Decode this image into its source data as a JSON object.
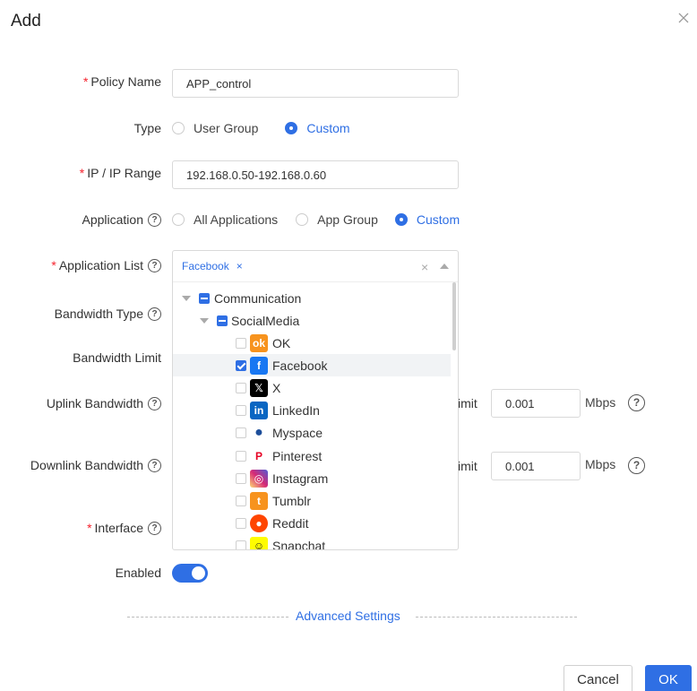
{
  "dialog": {
    "title": "Add"
  },
  "form": {
    "policy_name": {
      "label": "Policy Name",
      "value": "APP_control"
    },
    "type": {
      "label": "Type",
      "options": [
        "User Group",
        "Custom"
      ],
      "selected": "Custom"
    },
    "ip_range": {
      "label": "IP / IP Range",
      "value": "192.168.0.50-192.168.0.60"
    },
    "application": {
      "label": "Application",
      "options": [
        "All Applications",
        "App Group",
        "Custom"
      ],
      "selected": "Custom"
    },
    "application_list": {
      "label": "Application List",
      "selected_tag": "Facebook",
      "tag_remove": "×",
      "clear": "×",
      "tree": {
        "category": "Communication",
        "subcategory": "SocialMedia",
        "apps": [
          {
            "name": "OK",
            "checked": false,
            "icon": "ok-icon",
            "color": "#f7931e"
          },
          {
            "name": "Facebook",
            "checked": true,
            "icon": "facebook-icon",
            "color": "#1877f2"
          },
          {
            "name": "X",
            "checked": false,
            "icon": "x-icon",
            "color": "#000000"
          },
          {
            "name": "LinkedIn",
            "checked": false,
            "icon": "linkedin-icon",
            "color": "#0a66c2"
          },
          {
            "name": "Myspace",
            "checked": false,
            "icon": "myspace-icon",
            "color": "#1d4e9a"
          },
          {
            "name": "Pinterest",
            "checked": false,
            "icon": "pinterest-icon",
            "color": "#e60023"
          },
          {
            "name": "Instagram",
            "checked": false,
            "icon": "instagram-icon",
            "color": "#d62976"
          },
          {
            "name": "Tumblr",
            "checked": false,
            "icon": "tumblr-icon",
            "color": "#f7931e"
          },
          {
            "name": "Reddit",
            "checked": false,
            "icon": "reddit-icon",
            "color": "#ff4500"
          },
          {
            "name": "Snapchat",
            "checked": false,
            "icon": "snapchat-icon",
            "color": "#fffc00"
          }
        ]
      }
    },
    "bandwidth_type": {
      "label": "Bandwidth Type"
    },
    "bandwidth_limit": {
      "label": "Bandwidth Limit"
    },
    "uplink": {
      "label": "Uplink Bandwidth",
      "partial_label": "imit",
      "value": "0.001",
      "unit": "Mbps"
    },
    "downlink": {
      "label": "Downlink Bandwidth",
      "partial_label": "imit",
      "value": "0.001",
      "unit": "Mbps"
    },
    "interface": {
      "label": "Interface"
    },
    "enabled": {
      "label": "Enabled",
      "on": true
    }
  },
  "advanced": {
    "label": "Advanced Settings"
  },
  "buttons": {
    "cancel": "Cancel",
    "ok": "OK"
  },
  "colors": {
    "accent": "#2f6fe4",
    "required": "#f5222d"
  }
}
